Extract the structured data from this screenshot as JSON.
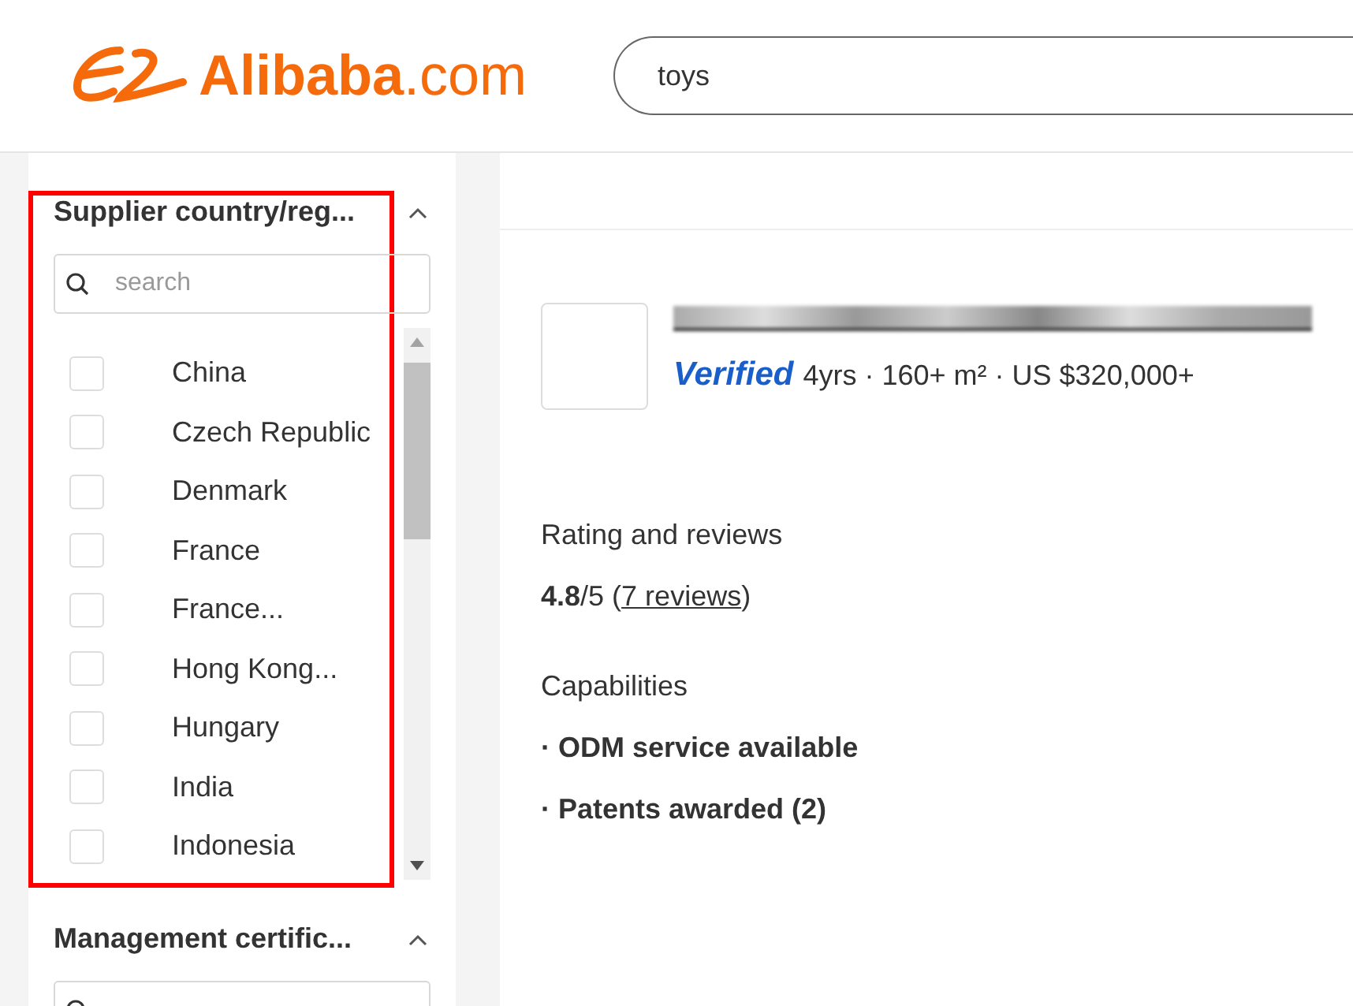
{
  "header": {
    "logo_text": "Alibaba",
    "logo_suffix": ".com",
    "search": {
      "value": "toys"
    }
  },
  "filters": [
    {
      "title": "Supplier country/reg...",
      "expanded": true,
      "highlighted": true,
      "search_placeholder": "search",
      "options": [
        {
          "label": "China",
          "checked": false
        },
        {
          "label": "Czech Republic",
          "checked": false
        },
        {
          "label": "Denmark",
          "checked": false
        },
        {
          "label": "France",
          "checked": false
        },
        {
          "label": "France...",
          "checked": false
        },
        {
          "label": "Hong Kong...",
          "checked": false
        },
        {
          "label": "Hungary",
          "checked": false
        },
        {
          "label": "India",
          "checked": false
        },
        {
          "label": "Indonesia",
          "checked": false
        }
      ]
    },
    {
      "title": "Management certific...",
      "expanded": true,
      "highlighted": false
    }
  ],
  "supplier": {
    "verified_label": "Verified",
    "facts": "4yrs · 160+ m² · US $320,000+",
    "rating_title": "Rating and reviews",
    "rating_prefix": "**4.8**/5 (",
    "rating_link": "7 reviews",
    "rating_suffix": ")",
    "capabilities_title": "Capabilities",
    "capabilities": [
      "· ODM service available",
      "· Patents awarded (2)"
    ]
  }
}
